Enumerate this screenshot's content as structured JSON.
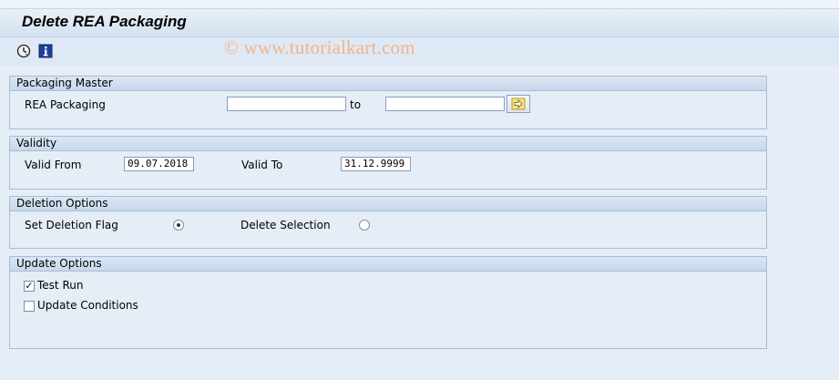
{
  "header": {
    "title": "Delete REA Packaging",
    "watermark": "© www.tutorialkart.com"
  },
  "toolbar": {
    "items": [
      {
        "icon": "execute-clock-icon"
      },
      {
        "icon": "info-icon"
      }
    ]
  },
  "groups": {
    "packaging": {
      "title": "Packaging Master",
      "rea_label": "REA Packaging",
      "rea_from_value": "",
      "to_label": "to",
      "rea_to_value": "",
      "multi_select_icon": "arrow-right-icon"
    },
    "validity": {
      "title": "Validity",
      "from_label": "Valid From",
      "from_value": "09.07.2018",
      "to_label": "Valid To",
      "to_value": "31.12.9999"
    },
    "deletion": {
      "title": "Deletion Options",
      "set_flag_label": "Set Deletion Flag",
      "set_flag_selected": true,
      "delete_selection_label": "Delete Selection",
      "delete_selection_selected": false
    },
    "update": {
      "title": "Update Options",
      "test_run_label": "Test Run",
      "test_run_checked": true,
      "update_conditions_label": "Update Conditions",
      "update_conditions_checked": false
    }
  }
}
